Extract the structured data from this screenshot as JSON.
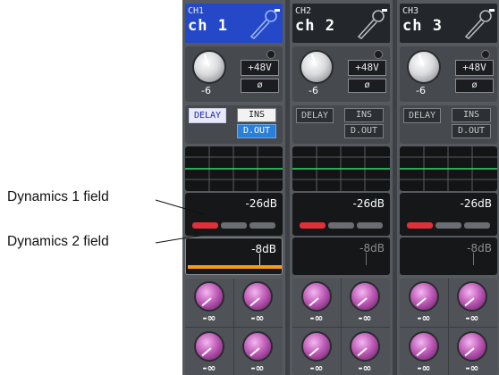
{
  "callouts": {
    "dyn1": "Dynamics 1 field",
    "dyn2": "Dynamics 2 field"
  },
  "channels": [
    {
      "id": "CH1",
      "name": "ch 1",
      "selected": true,
      "gain": "-6",
      "phantom": "+48V",
      "phase": "ø",
      "delay": "DELAY",
      "delay_on": true,
      "ins": "INS",
      "ins_on": true,
      "dout": "D.OUT",
      "dout_on": true,
      "dyn1_threshold": "-26dB",
      "dyn2_threshold": "-8dB",
      "dyn2_active": true,
      "send_levels": [
        "-∞",
        "-∞",
        "-∞",
        "-∞"
      ]
    },
    {
      "id": "CH2",
      "name": "ch 2",
      "selected": false,
      "gain": "-6",
      "phantom": "+48V",
      "phase": "ø",
      "delay": "DELAY",
      "delay_on": false,
      "ins": "INS",
      "ins_on": false,
      "dout": "D.OUT",
      "dout_on": false,
      "dyn1_threshold": "-26dB",
      "dyn2_threshold": "-8dB",
      "dyn2_active": false,
      "send_levels": [
        "-∞",
        "-∞",
        "-∞",
        "-∞"
      ]
    },
    {
      "id": "CH3",
      "name": "ch 3",
      "selected": false,
      "gain": "-6",
      "phantom": "+48V",
      "phase": "ø",
      "delay": "DELAY",
      "delay_on": false,
      "ins": "INS",
      "ins_on": false,
      "dout": "D.OUT",
      "dout_on": false,
      "dyn1_threshold": "-26dB",
      "dyn2_threshold": "-8dB",
      "dyn2_active": false,
      "send_levels": [
        "-∞",
        "-∞",
        "-∞",
        "-∞"
      ]
    }
  ],
  "icons": {
    "header": "microphone-icon",
    "gain": "gain-knob",
    "send": "send-level-knob"
  },
  "colors": {
    "selected_header": "#2448c8",
    "dout_on": "#2a7fd8",
    "gr_led": "#e0303a",
    "dyn2_bar": "#f59a1a",
    "send_knob": "#c05cb8",
    "eq_curve": "#2ee06a"
  }
}
